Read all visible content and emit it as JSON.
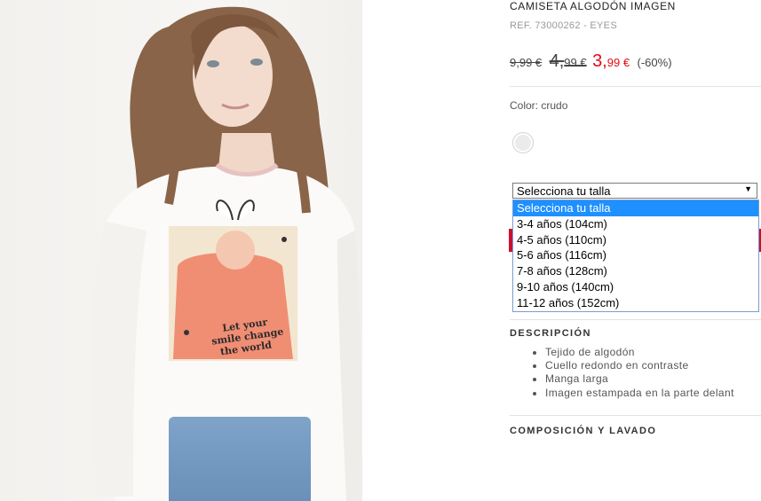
{
  "product": {
    "title": "CAMISETA ALGODÓN IMAGEN",
    "ref": "REF. 73000262 - EYES",
    "image_alt": "Camiseta algodón imagen",
    "print_text": [
      "Let your",
      "smile change",
      "the world"
    ]
  },
  "prices": {
    "original": "9,99 €",
    "previous_int": "4,",
    "previous_dec": "99 €",
    "current_int": "3,",
    "current_dec": "99 €",
    "discount": "(-60%)"
  },
  "color": {
    "label": "Color: crudo",
    "swatch_name": "crudo",
    "swatch_hex": "#ecebea"
  },
  "size_select": {
    "selected": "Selecciona tu talla",
    "options": [
      "Selecciona tu talla",
      "3-4 años (104cm)",
      "4-5 años (110cm)",
      "5-6 años (116cm)",
      "7-8 años (128cm)",
      "9-10 años (140cm)",
      "11-12 años (152cm)"
    ]
  },
  "description": {
    "title": "DESCRIPCIÓN",
    "items": [
      "Tejido de algodón",
      "Cuello redondo en contraste",
      "Manga larga",
      "Imagen estampada en la parte delant"
    ]
  },
  "composition": {
    "title": "COMPOSICIÓN Y LAVADO"
  },
  "colors": {
    "accent_red": "#e20a16",
    "select_highlight": "#1e90ff"
  }
}
